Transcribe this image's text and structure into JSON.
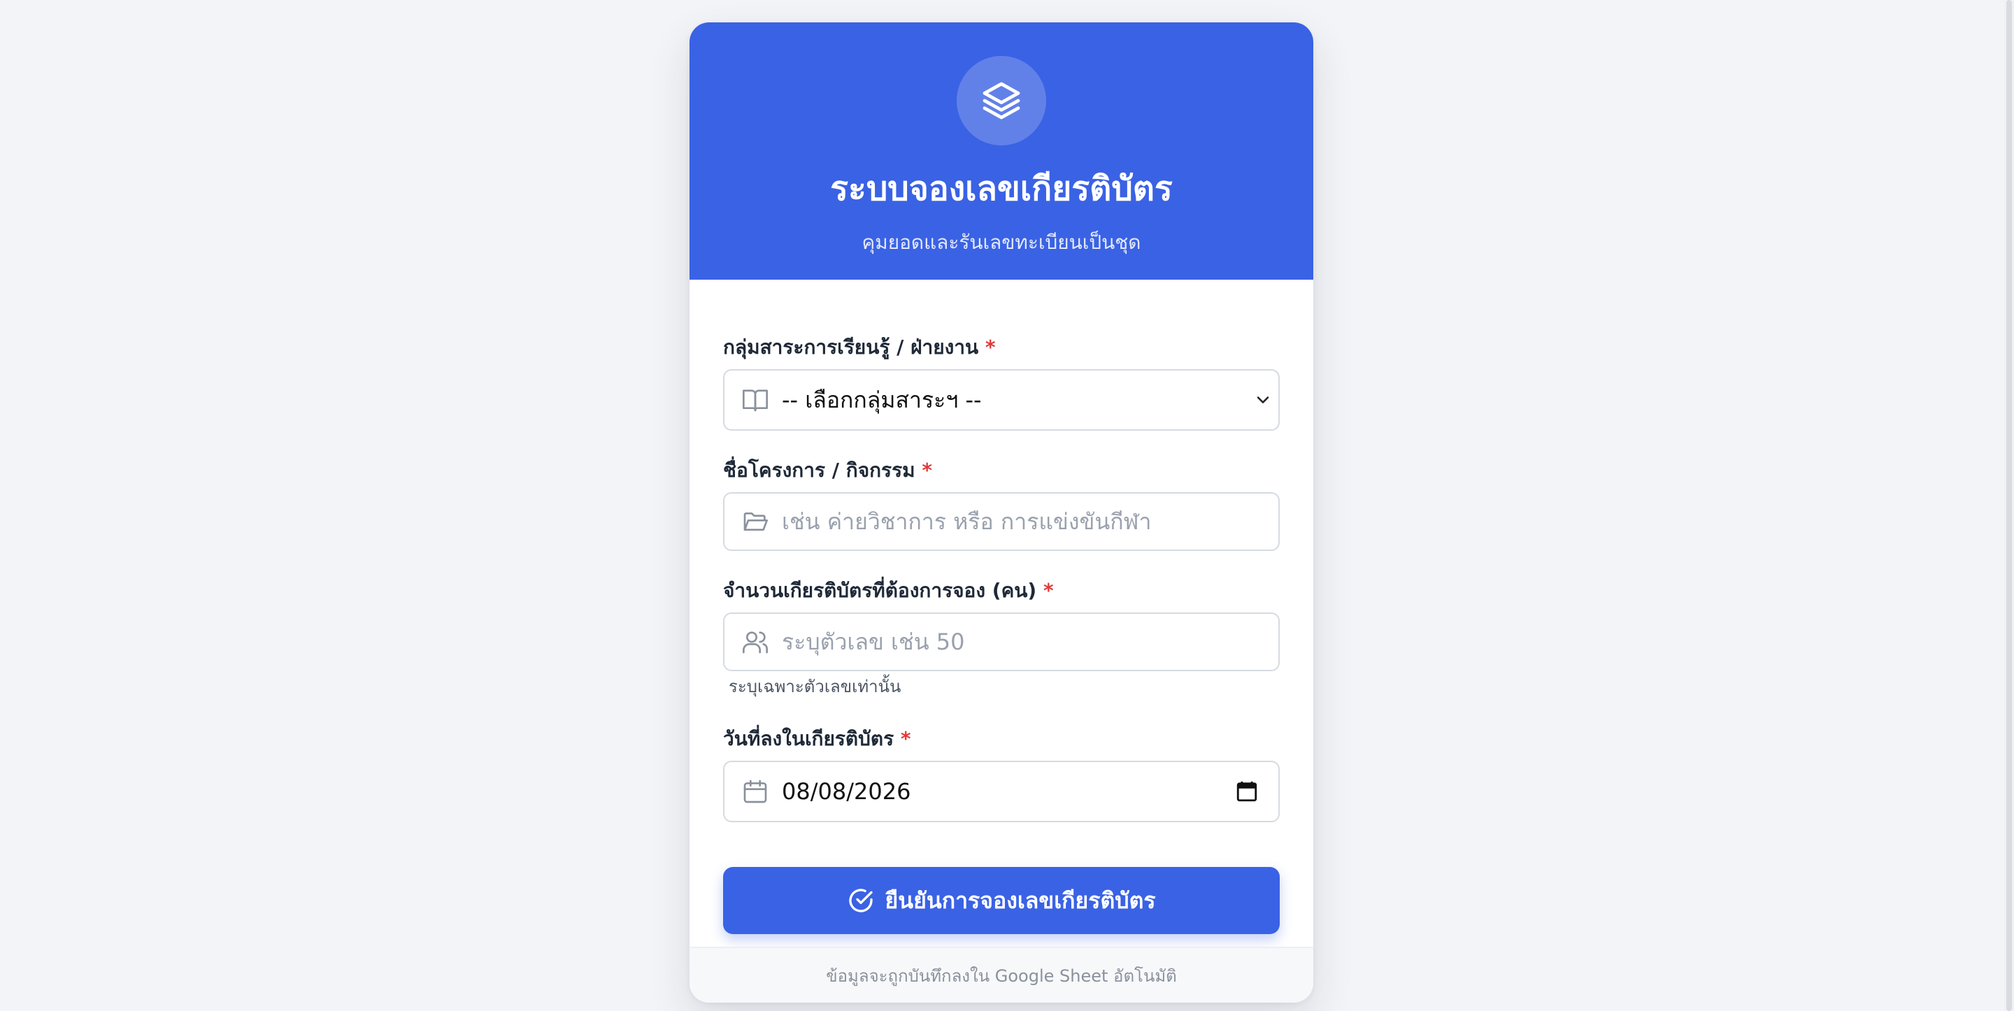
{
  "header": {
    "title": "ระบบจองเลขเกียรติบัตร",
    "subtitle": "คุมยอดและรันเลขทะเบียนเป็นชุด",
    "logo_icon": "layers-icon",
    "color": "#3a62e4"
  },
  "form": {
    "group": {
      "label": "กลุ่มสาระการเรียนรู้ / ฝ่ายงาน",
      "required_mark": "*",
      "icon": "book-open-icon",
      "selected": "-- เลือกกลุ่มสาระฯ --"
    },
    "project": {
      "label": "ชื่อโครงการ / กิจกรรม",
      "required_mark": "*",
      "icon": "folder-icon",
      "placeholder": "เช่น ค่ายวิชาการ หรือ การแข่งขันกีฬา",
      "value": ""
    },
    "quantity": {
      "label": "จำนวนเกียรติบัตรที่ต้องการจอง (คน)",
      "required_mark": "*",
      "icon": "users-icon",
      "placeholder": "ระบุตัวเลข เช่น 50",
      "hint": "ระบุเฉพาะตัวเลขเท่านั้น",
      "value": ""
    },
    "date": {
      "label": "วันที่ลงในเกียรติบัตร",
      "required_mark": "*",
      "icon": "calendar-icon",
      "value": "08/08/2026"
    },
    "submit": {
      "label": "ยืนยันการจองเลขเกียรติบัตร",
      "icon": "check-circle-icon"
    }
  },
  "footer": {
    "note": "ข้อมูลจะถูกบันทึกลงใน Google Sheet อัตโนมัติ"
  }
}
